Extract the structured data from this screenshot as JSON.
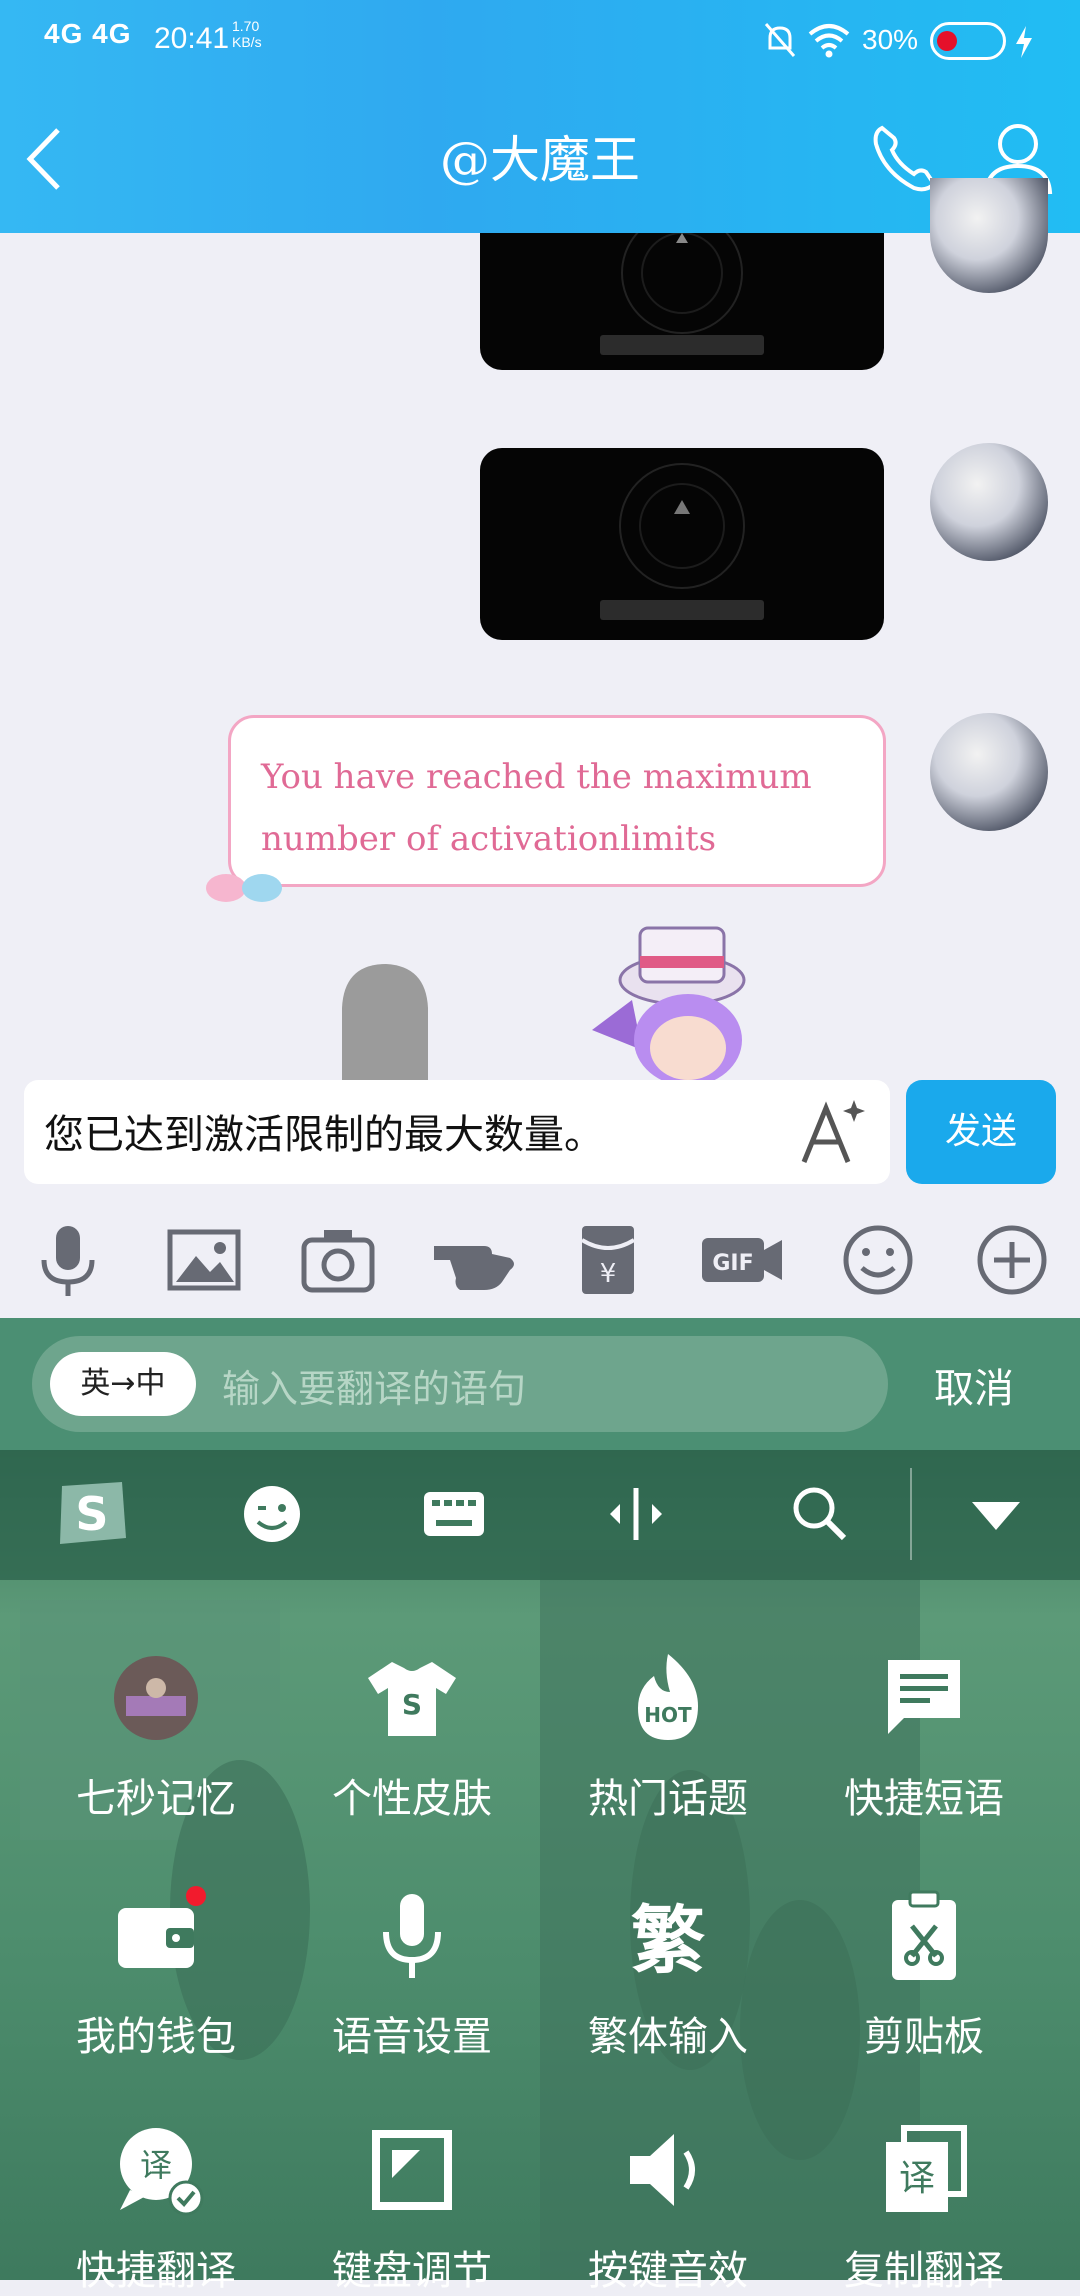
{
  "status_bar": {
    "network": "4G 4G",
    "time": "20:41",
    "speed": "1.70 KB/s",
    "battery": "30%"
  },
  "header": {
    "title": "@大魔王"
  },
  "chat": {
    "message_text": "You have reached the maximum number of  activationlimits"
  },
  "input": {
    "text": "您已达到激活限制的最大数量。",
    "send_label": "发送"
  },
  "translate": {
    "direction": "英→中",
    "placeholder": "输入要翻译的语句",
    "cancel_label": "取消"
  },
  "keyboard_grid": [
    {
      "label": "七秒记忆",
      "icon": "avatar-photo-icon"
    },
    {
      "label": "个性皮肤",
      "icon": "tshirt-icon"
    },
    {
      "label": "热门话题",
      "icon": "hot-flame-icon"
    },
    {
      "label": "快捷短语",
      "icon": "message-icon"
    },
    {
      "label": "我的钱包",
      "icon": "wallet-icon"
    },
    {
      "label": "语音设置",
      "icon": "microphone-icon"
    },
    {
      "label": "繁体输入",
      "icon": "traditional-char-icon"
    },
    {
      "label": "剪贴板",
      "icon": "clipboard-icon"
    },
    {
      "label": "快捷翻译",
      "icon": "translate-bubble-icon"
    },
    {
      "label": "键盘调节",
      "icon": "resize-icon"
    },
    {
      "label": "按键音效",
      "icon": "speaker-icon"
    },
    {
      "label": "复制翻译",
      "icon": "copy-translate-icon"
    }
  ],
  "colors": {
    "header_blue": "#2fa9f0",
    "send_blue": "#1aa9ec",
    "keyboard_green": "#4b8f73",
    "bubble_pink": "#f3a6c4"
  }
}
